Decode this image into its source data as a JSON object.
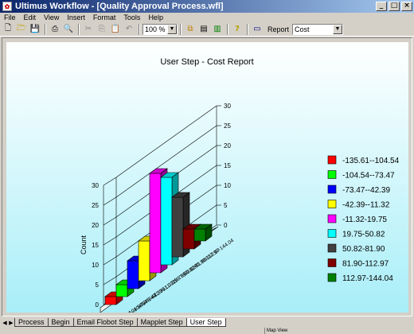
{
  "window": {
    "title": "Ultimus Workflow - [Quality Approval Process.wfl]"
  },
  "menu": [
    {
      "name": "menu-file",
      "label": "File"
    },
    {
      "name": "menu-edit",
      "label": "Edit"
    },
    {
      "name": "menu-view",
      "label": "View"
    },
    {
      "name": "menu-insert",
      "label": "Insert"
    },
    {
      "name": "menu-format",
      "label": "Format"
    },
    {
      "name": "menu-tools",
      "label": "Tools"
    },
    {
      "name": "menu-help",
      "label": "Help"
    }
  ],
  "toolbar": {
    "zoom": "100 %",
    "report_label": "Report",
    "report_value": "Cost"
  },
  "chart_data": {
    "type": "bar",
    "title": "User Step - Cost Report",
    "ylabel": "Count",
    "ylim": [
      0,
      30
    ],
    "yticks": [
      0,
      5,
      10,
      15,
      20,
      25,
      30
    ],
    "grid": true,
    "legend_position": "right",
    "categories": [
      "-135.61--104.54",
      "-104.54--73.47",
      "-73.47--42.39",
      "-42.39--11.32",
      "-11.32-19.75",
      "19.75-50.82",
      "50.82-81.90",
      "81.90-112.97",
      "112.97-144.04"
    ],
    "values": [
      2,
      3,
      7,
      10,
      25,
      22,
      15,
      5,
      3
    ],
    "colors": [
      "#ff0000",
      "#00ff00",
      "#0000ff",
      "#ffff00",
      "#ff00ff",
      "#00ffff",
      "#404040",
      "#800000",
      "#008000"
    ]
  },
  "tabs": [
    {
      "name": "tab-process",
      "label": "Process"
    },
    {
      "name": "tab-begin",
      "label": "Begin"
    },
    {
      "name": "tab-email-flobot-step",
      "label": "Email Flobot Step"
    },
    {
      "name": "tab-mapplet-step",
      "label": "Mapplet Step"
    },
    {
      "name": "tab-user-step",
      "label": "User Step",
      "active": true
    }
  ],
  "status": {
    "map_view": "Map View"
  }
}
